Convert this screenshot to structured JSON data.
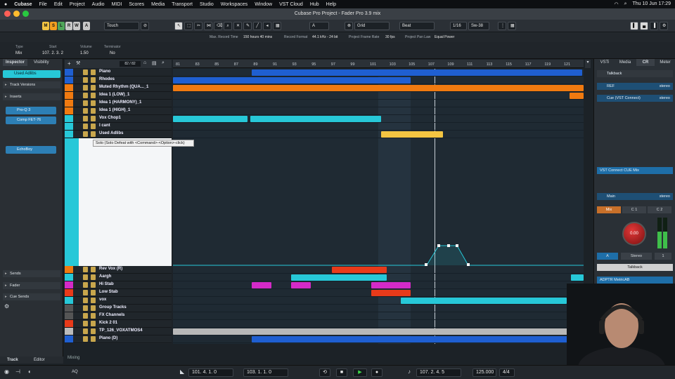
{
  "menubar": {
    "app": "Cubase",
    "items": [
      "File",
      "Edit",
      "Project",
      "Audio",
      "MIDI",
      "Scores",
      "Media",
      "Transport",
      "Studio",
      "Workspaces",
      "Window",
      "VST Cloud",
      "Hub",
      "Help"
    ],
    "clock": "Thu 10 Jun  17:29"
  },
  "window": {
    "title": "Cubase Pro Project - Fader Pro 3.9 mix"
  },
  "toolbar": {
    "m": "M",
    "s": "S",
    "l": "L",
    "r": "R",
    "w": "W",
    "a": "A",
    "automation_mode": "Touch",
    "marker": "A",
    "snap_type": "Grid",
    "quantize": "1/16",
    "swing": "Sw-38",
    "beat": "Beat"
  },
  "infoline": {
    "rec_time_label": "Max. Record Time",
    "rec_time": "150 hours 40 mins",
    "rec_format_label": "Record Format",
    "rec_format": "44.1 kHz - 24 bit",
    "frame_label": "Project Frame Rate",
    "frame": "30 fps",
    "pan_label": "Project Pan Law",
    "pan": "Equal Power"
  },
  "event_info": {
    "type_label": "Type",
    "type": "Mix",
    "start_label": "Start",
    "start": "107. 2. 3.   2",
    "vol_label": "Volume",
    "vol": "1.50",
    "term_label": "Terminator",
    "term": "No"
  },
  "inspector": {
    "tab1": "Inspector",
    "tab2": "Visibility",
    "track_name": "Used Adlibs",
    "sections": [
      "Track Versions",
      "Inserts",
      "Sends",
      "Fader",
      "Cue Sends"
    ],
    "plugins": [
      "Pro-Q 3",
      "Comp FET-76",
      "EchoBoy"
    ]
  },
  "track_header": {
    "count": "82 / 82"
  },
  "ruler": [
    "81",
    "83",
    "85",
    "87",
    "89",
    "91",
    "93",
    "95",
    "97",
    "99",
    "101",
    "103",
    "105",
    "107",
    "109",
    "111",
    "113",
    "115",
    "117",
    "119",
    "121"
  ],
  "tracks": [
    {
      "name": "Piano",
      "color": "#1f5fd1"
    },
    {
      "name": "Rhodes",
      "color": "#1f5fd1"
    },
    {
      "name": "Muted Rhythm (QUA..._1",
      "color": "#f07a10"
    },
    {
      "name": "Idea 1 (LOW)_1",
      "color": "#f07a10"
    },
    {
      "name": "Idea 1 (HARMONY)_1",
      "color": "#f07a10"
    },
    {
      "name": "Idea 1 (HIGH)_1",
      "color": "#f07a10"
    },
    {
      "name": "Vox Chop1",
      "color": "#27c8d8"
    },
    {
      "name": "I cant",
      "color": "#27c8d8"
    },
    {
      "name": "Used Adlibs",
      "color": "#27c8d8"
    },
    {
      "name": "Rev Vox (R)",
      "color": "#f07a10"
    },
    {
      "name": "Aargh",
      "color": "#27c8d8"
    },
    {
      "name": "Hi Stab",
      "color": "#d42ac8"
    },
    {
      "name": "Low Stab",
      "color": "#e83a1a"
    },
    {
      "name": "vox",
      "color": "#27c8d8"
    },
    {
      "name": "Group Tracks",
      "color": "#555"
    },
    {
      "name": "FX Channels",
      "color": "#555"
    },
    {
      "name": "Kick 2 01",
      "color": "#e83a1a"
    },
    {
      "name": "TP_126_VOXATMOS4",
      "color": "#bbbbbb"
    },
    {
      "name": "Piano (D)",
      "color": "#1f5fd1"
    }
  ],
  "tooltip": "Solo (Solo Defeat with <Command>-<Option>-click)",
  "right_zone": {
    "tabs": [
      "VSTi",
      "Media",
      "CR",
      "Meter"
    ],
    "talkback": "Talkback",
    "ref": "REF",
    "ref_fmt": "stereo",
    "cue": "Cue (VST Connect)",
    "cue_fmt": "stereo",
    "cue_mix": "VST Connect CUE Mix",
    "main": "Main",
    "main_fmt": "stereo",
    "mix": "Mix",
    "c1": "C 1",
    "c2": "C 2",
    "level": "0.00",
    "a": "A",
    "stereo": "Stereo",
    "one": "1",
    "talkback_btn": "Talkback",
    "adptr": "ADPTR MetricAB"
  },
  "bottom": {
    "track_tab": "Track",
    "editor_tab": "Editor",
    "mixing": "Mixing"
  },
  "transport": {
    "aq": "AQ",
    "left_loc": "101. 4. 1.  0",
    "right_loc": "103. 1. 1.  0",
    "position": "107. 2. 4.   5",
    "tempo": "125.000",
    "signature": "4/4"
  }
}
